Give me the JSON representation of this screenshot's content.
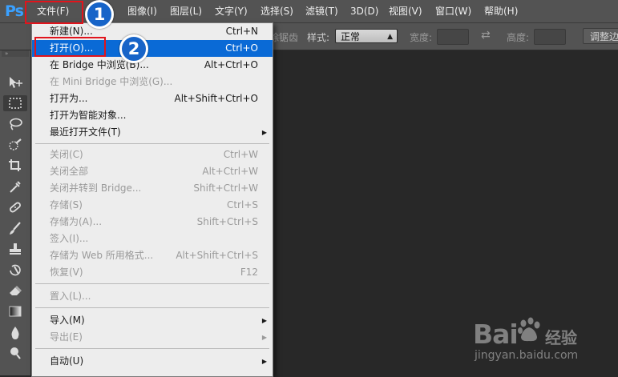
{
  "app": {
    "logo": "Ps"
  },
  "menubar": {
    "items": [
      {
        "label": "文件(F)"
      },
      {
        "label": "图像(I)"
      },
      {
        "label": "图层(L)"
      },
      {
        "label": "文字(Y)"
      },
      {
        "label": "选择(S)"
      },
      {
        "label": "滤镜(T)"
      },
      {
        "label": "3D(D)"
      },
      {
        "label": "视图(V)"
      },
      {
        "label": "窗口(W)"
      },
      {
        "label": "帮助(H)"
      }
    ]
  },
  "options_bar": {
    "partial_label": "除锯齿",
    "style_label": "样式:",
    "style_value": "正常",
    "width_label": "宽度:",
    "height_label": "高度:",
    "refine_edge_button": "调整边"
  },
  "toolbar": {
    "tools": [
      "move-tool-icon",
      "marquee-tool-icon",
      "lasso-tool-icon",
      "quick-select-tool-icon",
      "crop-tool-icon",
      "eyedropper-tool-icon",
      "healing-brush-tool-icon",
      "brush-tool-icon",
      "clone-stamp-tool-icon",
      "history-brush-tool-icon",
      "eraser-tool-icon",
      "gradient-tool-icon",
      "blur-tool-icon",
      "dodge-tool-icon"
    ]
  },
  "file_menu": {
    "items": [
      {
        "label": "新建(N)...",
        "shortcut": "Ctrl+N",
        "enabled": true,
        "highlighted": false,
        "submenu": false
      },
      {
        "label": "打开(O)...",
        "shortcut": "Ctrl+O",
        "enabled": true,
        "highlighted": true,
        "submenu": false
      },
      {
        "label": "在 Bridge 中浏览(B)...",
        "shortcut": "Alt+Ctrl+O",
        "enabled": true,
        "highlighted": false,
        "submenu": false
      },
      {
        "label": "在 Mini Bridge 中浏览(G)...",
        "shortcut": "",
        "enabled": false,
        "highlighted": false,
        "submenu": false
      },
      {
        "label": "打开为...",
        "shortcut": "Alt+Shift+Ctrl+O",
        "enabled": true,
        "highlighted": false,
        "submenu": false
      },
      {
        "label": "打开为智能对象...",
        "shortcut": "",
        "enabled": true,
        "highlighted": false,
        "submenu": false
      },
      {
        "label": "最近打开文件(T)",
        "shortcut": "",
        "enabled": true,
        "highlighted": false,
        "submenu": true
      },
      {
        "separator": true
      },
      {
        "label": "关闭(C)",
        "shortcut": "Ctrl+W",
        "enabled": false,
        "highlighted": false,
        "submenu": false
      },
      {
        "label": "关闭全部",
        "shortcut": "Alt+Ctrl+W",
        "enabled": false,
        "highlighted": false,
        "submenu": false
      },
      {
        "label": "关闭并转到 Bridge...",
        "shortcut": "Shift+Ctrl+W",
        "enabled": false,
        "highlighted": false,
        "submenu": false
      },
      {
        "label": "存储(S)",
        "shortcut": "Ctrl+S",
        "enabled": false,
        "highlighted": false,
        "submenu": false
      },
      {
        "label": "存储为(A)...",
        "shortcut": "Shift+Ctrl+S",
        "enabled": false,
        "highlighted": false,
        "submenu": false
      },
      {
        "label": "签入(I)...",
        "shortcut": "",
        "enabled": false,
        "highlighted": false,
        "submenu": false
      },
      {
        "label": "存储为 Web 所用格式...",
        "shortcut": "Alt+Shift+Ctrl+S",
        "enabled": false,
        "highlighted": false,
        "submenu": false
      },
      {
        "label": "恢复(V)",
        "shortcut": "F12",
        "enabled": false,
        "highlighted": false,
        "submenu": false
      },
      {
        "separator": true
      },
      {
        "label": "置入(L)...",
        "shortcut": "",
        "enabled": false,
        "highlighted": false,
        "submenu": false
      },
      {
        "separator": true
      },
      {
        "label": "导入(M)",
        "shortcut": "",
        "enabled": true,
        "highlighted": false,
        "submenu": true
      },
      {
        "label": "导出(E)",
        "shortcut": "",
        "enabled": false,
        "highlighted": false,
        "submenu": true
      },
      {
        "separator": true
      },
      {
        "label": "自动(U)",
        "shortcut": "",
        "enabled": true,
        "highlighted": false,
        "submenu": true
      }
    ]
  },
  "annotations": {
    "step1": "1",
    "step2": "2",
    "callout_color": "#e1141c",
    "badge_color": "#1764c8"
  },
  "watermark": {
    "logo": "Bai",
    "logo_suffix": "经验",
    "url": "jingyan.baidu.com"
  }
}
